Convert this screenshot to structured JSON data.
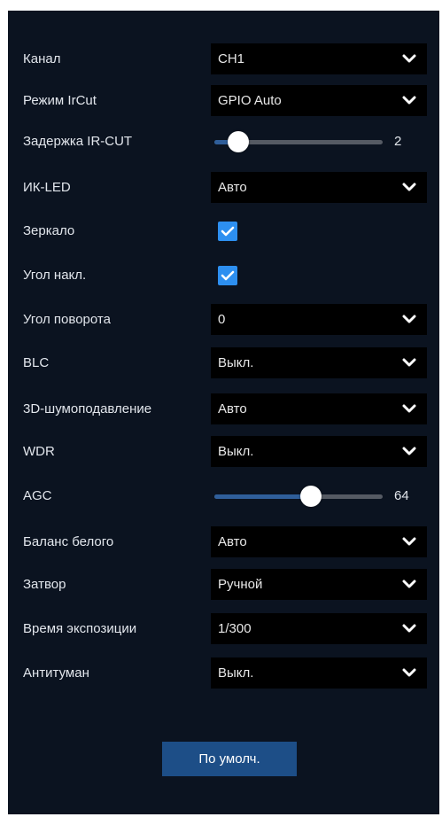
{
  "colors": {
    "panel_bg": "#0b1320",
    "select_bg": "#000000",
    "accent": "#2d8ff0",
    "button_bg": "#1d4e87",
    "slider_fill": "#2f5e9a"
  },
  "settings": [
    {
      "key": "channel",
      "label": "Канал",
      "type": "select",
      "value": "CH1"
    },
    {
      "key": "ircut_mode",
      "label": "Режим IrCut",
      "type": "select",
      "value": "GPIO Auto"
    },
    {
      "key": "ircut_delay",
      "label": "Задержка IR-CUT",
      "type": "slider",
      "value": "2",
      "fraction": 0.08
    },
    {
      "key": "ir_led",
      "label": "ИК-LED",
      "type": "select",
      "value": "Авто"
    },
    {
      "key": "mirror",
      "label": "Зеркало",
      "type": "checkbox",
      "checked": true
    },
    {
      "key": "flip",
      "label": "Угол накл.",
      "type": "checkbox",
      "checked": true
    },
    {
      "key": "rotation",
      "label": "Угол поворота",
      "type": "select",
      "value": "0"
    },
    {
      "key": "blc",
      "label": "BLC",
      "type": "select",
      "value": "Выкл."
    },
    {
      "key": "dnr_3d",
      "label": "3D-шумоподавление",
      "type": "select",
      "value": "Авто"
    },
    {
      "key": "wdr",
      "label": "WDR",
      "type": "select",
      "value": "Выкл."
    },
    {
      "key": "agc",
      "label": "AGC",
      "type": "slider",
      "value": "64",
      "fraction": 0.51
    },
    {
      "key": "white_balance",
      "label": "Баланс белого",
      "type": "select",
      "value": "Авто"
    },
    {
      "key": "shutter",
      "label": "Затвор",
      "type": "select",
      "value": "Ручной"
    },
    {
      "key": "exposure_time",
      "label": "Время экспозиции",
      "type": "select",
      "value": "1/300"
    },
    {
      "key": "defog",
      "label": "Антитуман",
      "type": "select",
      "value": "Выкл."
    }
  ],
  "default_button": {
    "label": "По умолч."
  },
  "icons": {
    "select_arrow": "chevron-down-icon",
    "checkbox_mark": "checkmark-icon"
  }
}
